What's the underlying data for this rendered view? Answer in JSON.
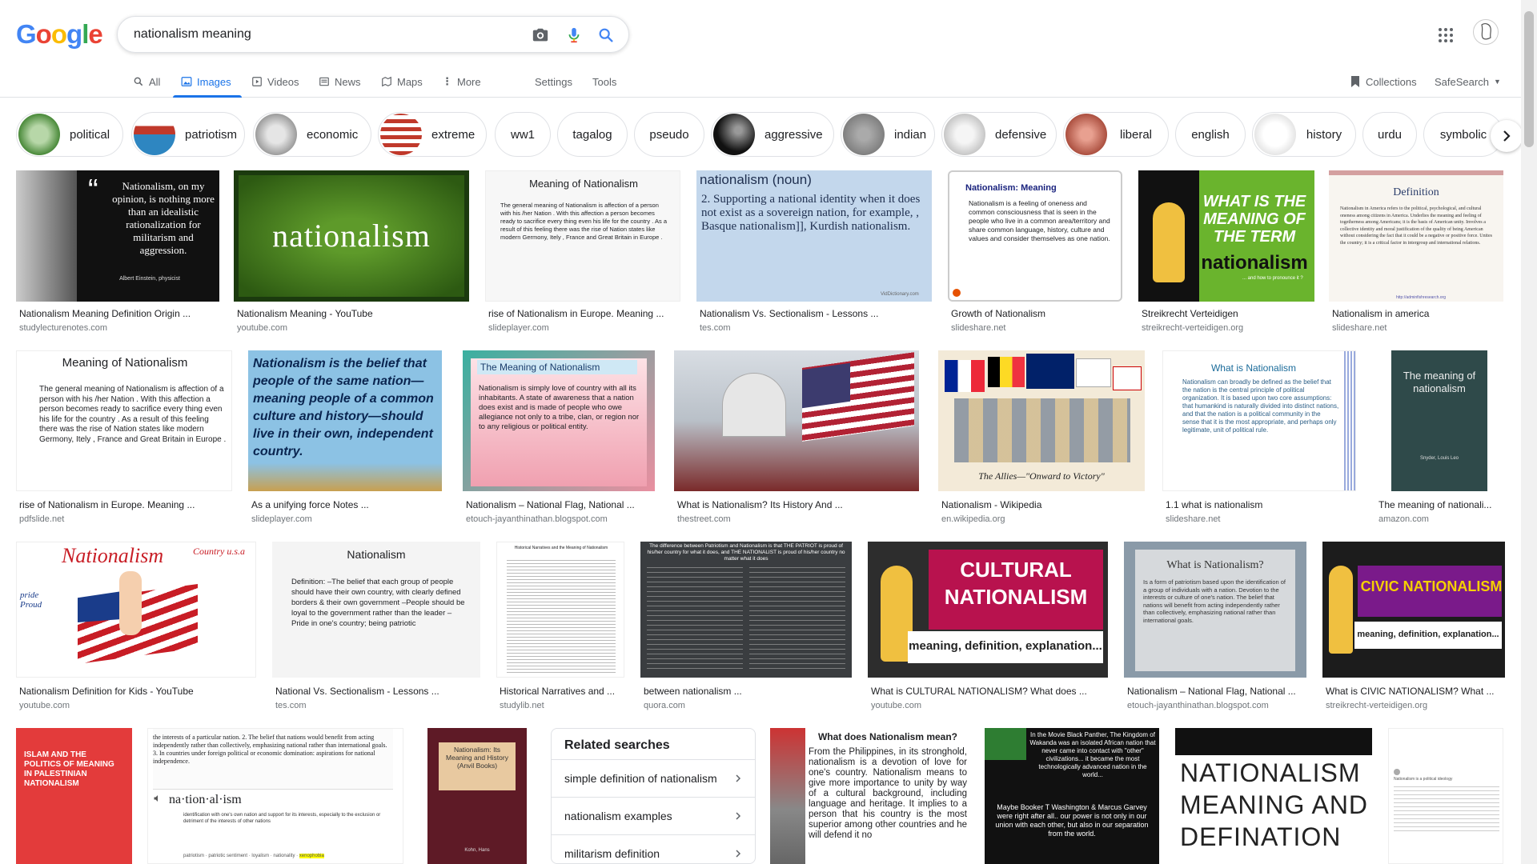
{
  "logo": {
    "letters": [
      "G",
      "o",
      "o",
      "g",
      "l",
      "e"
    ],
    "colors": [
      "#4285f4",
      "#ea4335",
      "#fbbc05",
      "#4285f4",
      "#34a853",
      "#ea4335"
    ]
  },
  "search": {
    "value": "nationalism meaning",
    "placeholder": ""
  },
  "icons": {
    "camera": "camera-icon",
    "mic": "mic-icon",
    "search": "search-icon",
    "apps": "apps-grid-icon"
  },
  "tabs": [
    {
      "label": "All",
      "icon": "search-icon"
    },
    {
      "label": "Images",
      "icon": "image-icon"
    },
    {
      "label": "Videos",
      "icon": "video-icon"
    },
    {
      "label": "News",
      "icon": "news-icon"
    },
    {
      "label": "Maps",
      "icon": "map-icon"
    },
    {
      "label": "More",
      "icon": "more-vert-icon"
    }
  ],
  "tools": {
    "settings": "Settings",
    "tools": "Tools",
    "collections": "Collections",
    "safesearch": "SafeSearch"
  },
  "chips": [
    "political",
    "patriotism",
    "economic",
    "extreme",
    "ww1",
    "tagalog",
    "pseudo",
    "aggressive",
    "indian",
    "defensive",
    "liberal",
    "english",
    "history",
    "urdu",
    "symbolic"
  ],
  "results": [
    {
      "caption": "Nationalism Meaning Definition Origin ...",
      "source": "studylecturenotes.com",
      "text": "Nationalism, on my opinion, is nothing more than an idealistic rationalization for militarism and aggression.",
      "sub": "Albert Einstein, physicist"
    },
    {
      "caption": "Nationalism Meaning - YouTube",
      "source": "youtube.com",
      "text": "nationalism"
    },
    {
      "caption": "rise of Nationalism in Europe. Meaning ...",
      "source": "slideplayer.com",
      "title": "Meaning of Nationalism",
      "text": "The general meaning of Nationalism is affection of a person with his /her Nation . With this affection a person becomes ready to sacrifice every thing even his life for the country . As a result of this feeling there was the rise of Nation states like modern Germony, Itely , France and Great Britain in Europe ."
    },
    {
      "caption": "Nationalism Vs. Sectionalism - Lessons ...",
      "source": "tes.com",
      "title": "nationalism (noun)",
      "text": "2. Supporting a national identity when it does not exist as a sovereign nation, for example, , Basque nationalism]], Kurdish nationalism.",
      "sub": "VidDictionary.com"
    },
    {
      "caption": "Growth of Nationalism",
      "source": "slideshare.net",
      "title": "Nationalism: Meaning",
      "text": "Nationalism is a feeling of oneness and common consciousness that is seen in the people who live in a common area/territory and share common language, history, culture and values and consider themselves as one nation."
    },
    {
      "caption": "Streikrecht Verteidigen",
      "source": "streikrecht-verteidigen.org",
      "title": "WHAT IS THE MEANING OF THE TERM",
      "text": "nationalism",
      "sub": "... and how to pronounce it ?"
    },
    {
      "caption": "Nationalism in america",
      "source": "slideshare.net",
      "title": "Definition",
      "text": "Nationalism in America refers to the political, psychological, and cultural oneness among citizens in America. Underlies the meaning and feeling of togetherness among Americans; it is the basis of American unity. Involves a collective identity and moral justification of the quality of being American without considering the fact that it could be a negative or positive force. Unites the country; it is a critical factor in intergroup and international relations.",
      "sub": "http://adminfishresearch.org"
    },
    {
      "caption": "rise of Nationalism in Europe. Meaning ...",
      "source": "pdfslide.net",
      "title": "Meaning of Nationalism",
      "text": "The general meaning of Nationalism is affection of a person with his /her Nation . With this affection a person becomes ready to sacrifice every thing even his life for the country . As a result of this feeling there was the rise of Nation states like modern Germony, Itely , France and Great Britain in Europe ."
    },
    {
      "caption": "As a unifying force Notes ...",
      "source": "slideplayer.com",
      "text": "Nationalism is the belief that people of the same nation—meaning people of a common culture and history—should live in their own, independent country."
    },
    {
      "caption": "Nationalism – National Flag, National ...",
      "source": "etouch-jayanthinathan.blogspot.com",
      "title": "The Meaning of Nationalism",
      "text": "Nationalism is simply love of country with all its inhabitants. A state of awareness that a nation does exist and is made of people who owe allegiance not only to a tribe, clan, or region nor to any religious or political entity."
    },
    {
      "caption": "What is Nationalism? Its History And ...",
      "source": "thestreet.com"
    },
    {
      "caption": "Nationalism - Wikipedia",
      "source": "en.wikipedia.org",
      "text": "The Allies—\"Onward to Victory\""
    },
    {
      "caption": "1.1 what is nationalism",
      "source": "slideshare.net",
      "title": "What is Nationalism",
      "text": "Nationalism can broadly be defined as the belief that the nation is the central principle of political organization. It is based upon two core assumptions: that humankind is naturally divided into distinct nations, and that the nation is a political community in the sense that it is the most appropriate, and perhaps only legitimate, unit of political rule."
    },
    {
      "caption": "The meaning of nationali...",
      "source": "amazon.com",
      "title": "The meaning of nationalism",
      "sub": "Snyder, Louis Leo"
    },
    {
      "caption": "Nationalism Definition for Kids - YouTube",
      "source": "youtube.com",
      "title": "Nationalism",
      "text": "Country u.s.a",
      "sub": "pride Proud"
    },
    {
      "caption": "National Vs. Sectionalism - Lessons ...",
      "source": "tes.com",
      "title": "Nationalism",
      "text": "Definition: –The belief that each group of people should have their own country, with clearly defined borders & their own government –People should be loyal to the government rather than the leader –Pride in one's country; being patriotic"
    },
    {
      "caption": "Historical Narratives and ...",
      "source": "studylib.net",
      "title": "Historical Narratives and the Meaning of Nationalism"
    },
    {
      "caption": "between nationalism ...",
      "source": "quora.com",
      "title": "The difference between Patriotism and Nationalism is that THE PATRIOT is proud of his/her country for what it does, and THE NATIONALIST is proud of his/her country no matter what it does"
    },
    {
      "caption": "What is CULTURAL NATIONALISM? What does ...",
      "source": "youtube.com",
      "title": "CULTURAL NATIONALISM",
      "text": "meaning, definition, explanation..."
    },
    {
      "caption": "Nationalism – National Flag, National ...",
      "source": "etouch-jayanthinathan.blogspot.com",
      "title": "What is Nationalism?",
      "text": "Is a form of patriotism based upon the identification of a group of individuals with a nation. Devotion to the interests or culture of one's nation. The belief that nations will benefit from acting independently rather than collectively, emphasizing national rather than international goals."
    },
    {
      "caption": "What is CIVIC NATIONALISM? What ...",
      "source": "streikrecht-verteidigen.org",
      "title": "CIVIC NATIONALISM",
      "text": "meaning, definition, explanation..."
    },
    {
      "title": "ISLAM AND THE POLITICS OF MEANING IN PALESTINIAN NATIONALISM"
    },
    {
      "title": "na·tion·al·ism",
      "text": "identification with one's own nation and support for its interests, especially to the exclusion or detriment of the interests of other nations",
      "sub": "the interests of a particular nation. 2. The belief that nations would benefit from acting independently rather than collectively, emphasizing national rather than international goals. 3. In countries under foreign political or economic domination: aspirations for national independence.",
      "tags": [
        "patriotism",
        "patriotic sentiment",
        "loyalism",
        "nationality",
        "xenophobia"
      ]
    },
    {
      "title": "Nationalism: Its Meaning and History (Anvil Books)",
      "sub": "Kohn, Hans"
    },
    {
      "title": "What does Nationalism mean?",
      "text": "From the Philippines, in its stronghold, nationalism is a devotion of love for one's country. Nationalism means to give more importance to unity by way of a cultural background, including language and heritage. It implies to a person that his country is the most superior among other countries and he will defend it no"
    },
    {
      "title": "In the Movie Black Panther, The Kingdom of Wakanda was an isolated African nation that never came into contact with \"other\" civilizations... it became the most technologically advanced nation in the world...",
      "text": "Maybe Booker T Washington & Marcus Garvey were right after all.. our power is not only in our union with each other, but also in our separation from the world."
    },
    {
      "title": "NATIONALISM MEANING AND DEFINATION"
    },
    {
      "text": "Nationalism is a political ideology"
    }
  ],
  "related": {
    "title": "Related searches",
    "items": [
      "simple definition of nationalism",
      "nationalism examples",
      "militarism definition"
    ]
  }
}
